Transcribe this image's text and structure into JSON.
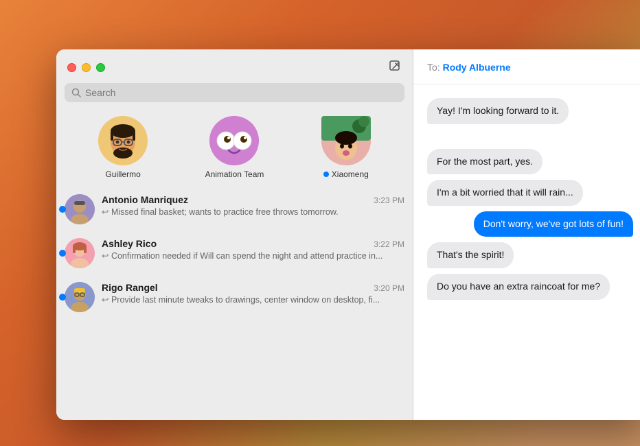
{
  "background": {
    "description": "macOS desktop gradient orange background"
  },
  "window": {
    "titlebar": {
      "compose_label": "✏"
    },
    "search": {
      "placeholder": "Search"
    },
    "pinned": [
      {
        "id": "guillermo",
        "name": "Guillermo",
        "emoji": "🧔",
        "online": false,
        "bg": "#f0c875"
      },
      {
        "id": "animation-team",
        "name": "Animation Team",
        "emoji": "👀",
        "online": false,
        "bg": "#d080d0"
      },
      {
        "id": "xiaomeng",
        "name": "Xiaomeng",
        "emoji": "🧝",
        "online": true,
        "bg": "#e8b0b0"
      }
    ],
    "messages": [
      {
        "id": "antonio",
        "sender": "Antonio Manriquez",
        "time": "3:23 PM",
        "preview": "Missed final basket; wants to practice free throws tomorrow.",
        "unread": true,
        "emoji": "🧓",
        "bg": "#9b8ec4"
      },
      {
        "id": "ashley",
        "sender": "Ashley Rico",
        "time": "3:22 PM",
        "preview": "Confirmation needed if Will can spend the night and attend practice in...",
        "unread": true,
        "emoji": "👧",
        "bg": "#f4a0b0"
      },
      {
        "id": "rigo",
        "sender": "Rigo Rangel",
        "time": "3:20 PM",
        "preview": "Provide last minute tweaks to drawings, center window on desktop, fi...",
        "unread": true,
        "emoji": "🧑",
        "bg": "#8898cc"
      }
    ],
    "chat": {
      "to_label": "To:",
      "to_name": "Rody Albuerne",
      "bubbles": [
        {
          "id": "b1",
          "text": "Yay! I'm looking forward to it.",
          "type": "received"
        },
        {
          "id": "b2",
          "text": "For the most part, yes.",
          "type": "received"
        },
        {
          "id": "b3",
          "text": "I'm a bit worried that it will rain...",
          "type": "received"
        },
        {
          "id": "b4",
          "text": "Don't worry, we've got lots of fun!",
          "type": "sent"
        },
        {
          "id": "b5",
          "text": "That's the spirit!",
          "type": "received"
        },
        {
          "id": "b6",
          "text": "Do you have an extra raincoat for me?",
          "type": "received"
        }
      ]
    }
  }
}
